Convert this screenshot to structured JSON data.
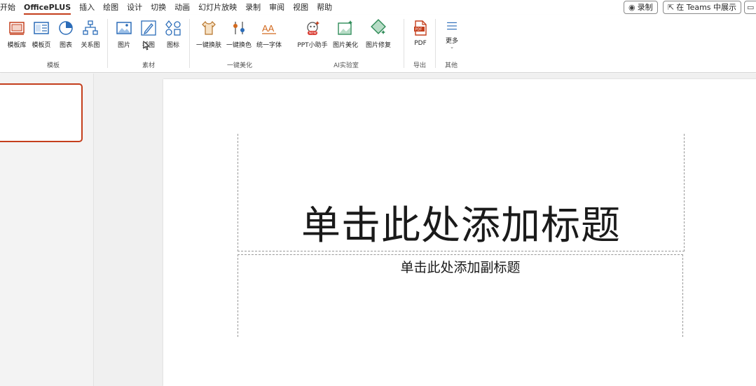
{
  "tabs": [
    {
      "label": "开始",
      "active": false
    },
    {
      "label": "OfficePLUS",
      "active": true
    },
    {
      "label": "插入",
      "active": false
    },
    {
      "label": "绘图",
      "active": false
    },
    {
      "label": "设计",
      "active": false
    },
    {
      "label": "切换",
      "active": false
    },
    {
      "label": "动画",
      "active": false
    },
    {
      "label": "幻灯片放映",
      "active": false
    },
    {
      "label": "录制",
      "active": false
    },
    {
      "label": "审阅",
      "active": false
    },
    {
      "label": "视图",
      "active": false
    },
    {
      "label": "帮助",
      "active": false
    }
  ],
  "top_buttons": {
    "record_label": "录制",
    "teams_label": "在 Teams 中展示"
  },
  "ribbon": {
    "groups": {
      "template": "模板",
      "material": "素材",
      "beautify": "一键美化",
      "ai_lab": "AI实验室",
      "export": "导出",
      "other": "其他"
    },
    "buttons": {
      "template_lib": "模板库",
      "template_page": "模板页",
      "chart": "图表",
      "relation_chart": "关系图",
      "picture": "图片",
      "illustration": "插图",
      "icon": "图标",
      "one_click_skin": "一键换肤",
      "one_click_color": "一键换色",
      "unify_font": "统一字体",
      "ppt_assistant": "PPT小助手",
      "picture_beautify": "图片美化",
      "picture_restore": "图片修复",
      "pdf": "PDF",
      "more": "更多"
    },
    "badge_new": "NEW"
  },
  "slide": {
    "title_placeholder": "单击此处添加标题",
    "subtitle_placeholder": "单击此处添加副标题"
  },
  "colors": {
    "accent": "#c43e1c",
    "icon_blue": "#2b6cb8",
    "icon_orange": "#d2691e",
    "icon_green": "#2e8b57"
  }
}
